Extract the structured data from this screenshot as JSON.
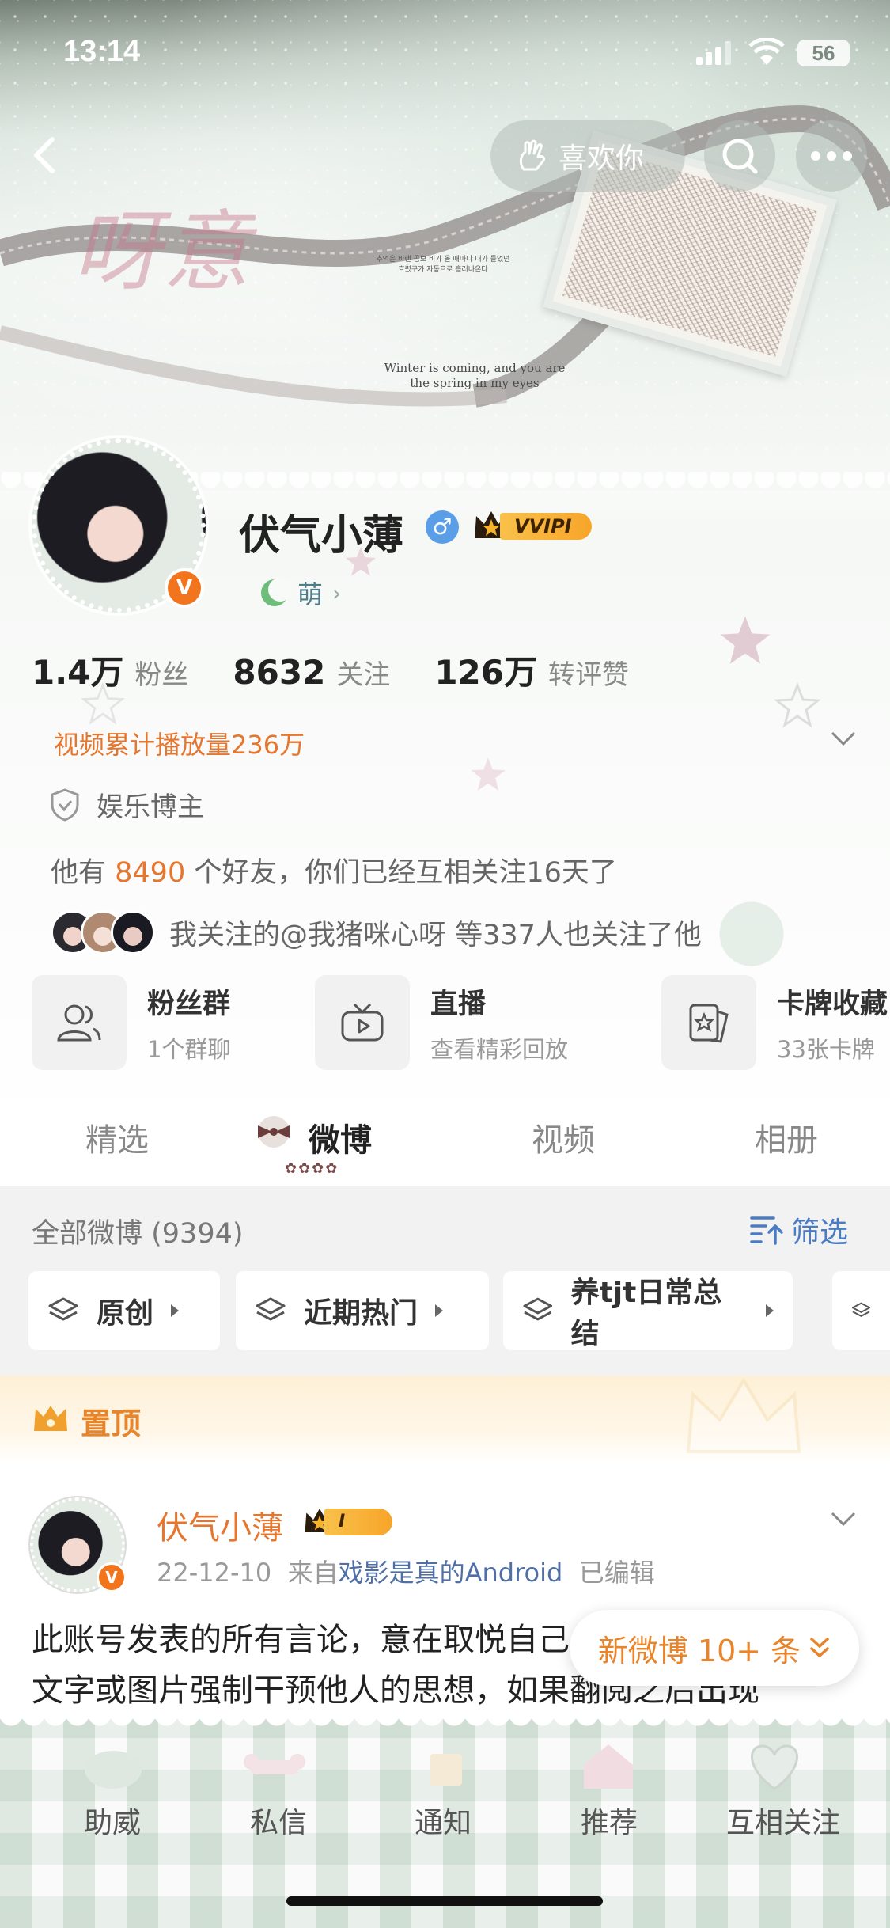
{
  "status_bar": {
    "time": "13:14",
    "battery": "56"
  },
  "banner": {
    "script_text": "呀意",
    "korean_lines": [
      "추억은 바랜 곰보 비가 올 때마다 내가 들었던",
      "흐렸구가 자동으로 흘러나온다"
    ],
    "english_lines": [
      "Winter is coming, and you are",
      "the spring in my eyes"
    ]
  },
  "nav": {
    "like_label": "喜欢你"
  },
  "profile": {
    "name": "伏气小薄",
    "vip_label": "VVIP",
    "vip_level": "I",
    "verified_badge": "V",
    "tag": "萌",
    "stats": [
      {
        "num": "1.4万",
        "label": "粉丝"
      },
      {
        "num": "8632",
        "label": "关注"
      },
      {
        "num": "126万",
        "label": "转评赞"
      }
    ],
    "plays": "视频累计播放量236万",
    "identity": "娱乐博主",
    "friends_prefix": "他有 ",
    "friends_count": "8490",
    "friends_suffix": " 个好友，你们已经互相关注16天了",
    "mutual": "我关注的@我猪咪心呀 等337人也关注了他"
  },
  "features": [
    {
      "title": "粉丝群",
      "sub": "1个群聊",
      "icon": "group-icon"
    },
    {
      "title": "直播",
      "sub": "查看精彩回放",
      "icon": "tv-icon"
    },
    {
      "title": "卡牌收藏",
      "sub": "33张卡牌",
      "icon": "card-icon"
    }
  ],
  "tabs": [
    "精选",
    "微博",
    "视频",
    "相册"
  ],
  "active_tab": "微博",
  "filter": {
    "all_label": "全部微博 (9394)",
    "filter_label": "筛选",
    "chips": [
      "原创",
      "近期热门",
      "养tjt日常总结"
    ]
  },
  "pinned_label": "置顶",
  "post": {
    "name": "伏气小薄",
    "vip_level": "I",
    "date": "22-12-10",
    "from_prefix": "来自",
    "source": "戏影是真的Android",
    "edited": "已编辑",
    "body": "此账号发表的所有言论，意在取悦自己，没有任何人可以用文字或图片强制干预他人的思想，如果翻阅之后出现"
  },
  "new_posts_label": "新微博 10+ 条",
  "bottom_nav": [
    "助威",
    "私信",
    "通知",
    "推荐",
    "互相关注"
  ],
  "colors": {
    "accent_orange": "#e6762e",
    "link_blue": "#4a7cc4",
    "vip_gold": "#f7a52a"
  }
}
